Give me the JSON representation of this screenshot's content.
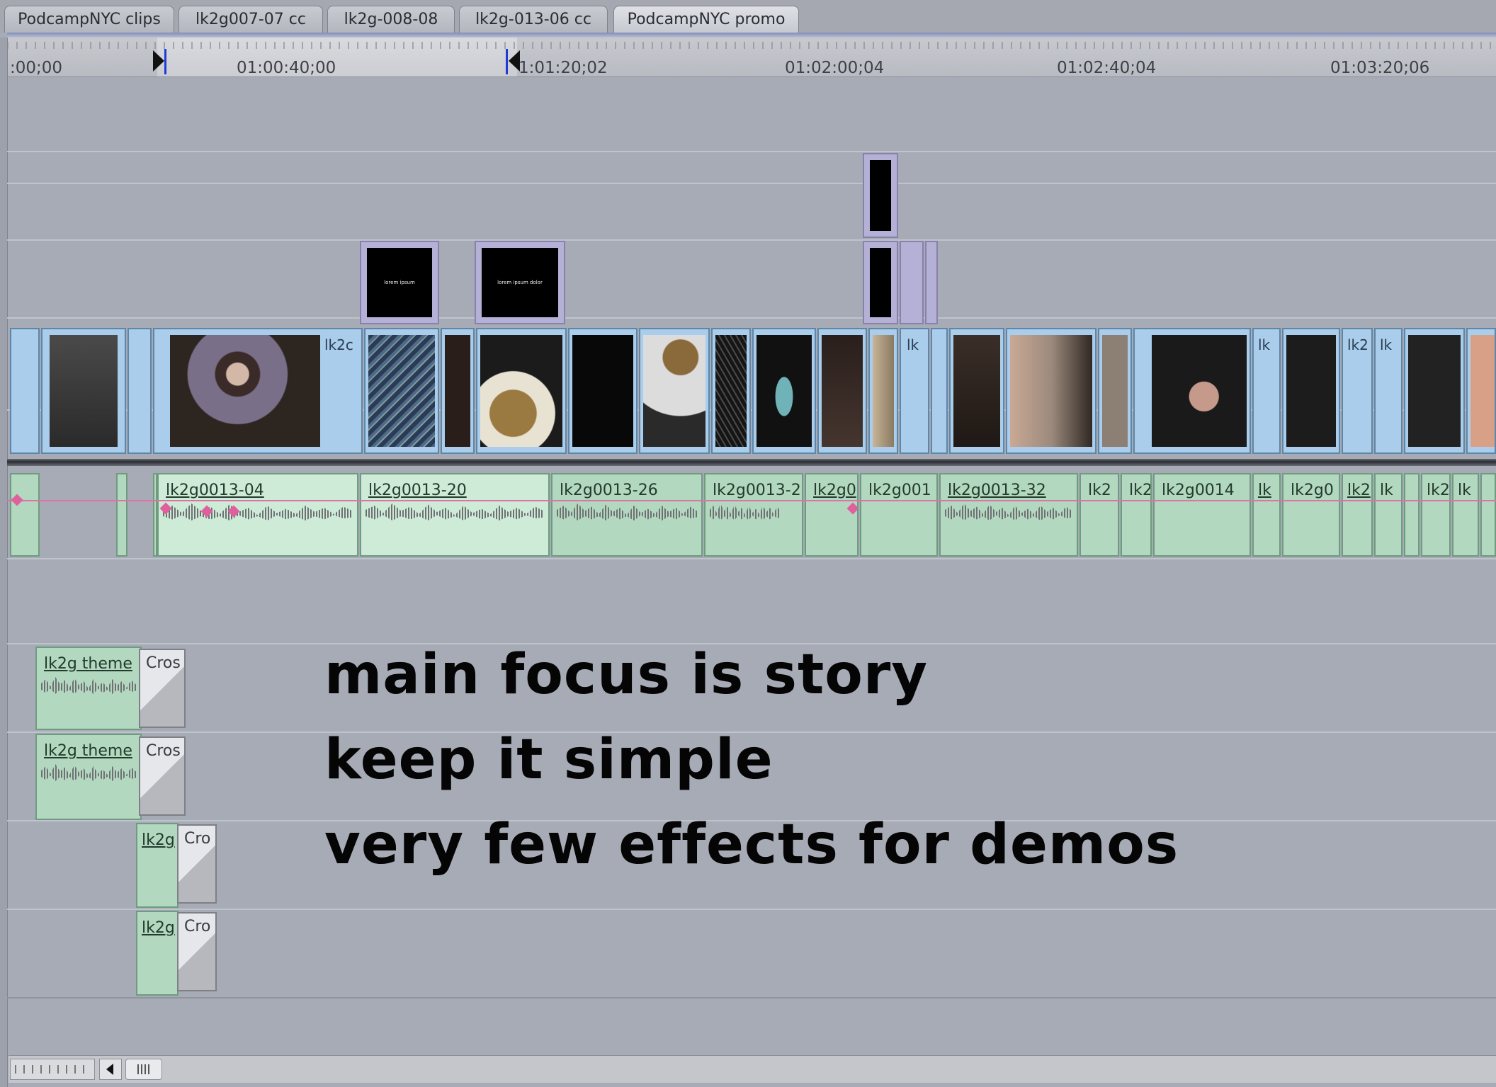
{
  "tabs": [
    {
      "label": "PodcampNYC clips"
    },
    {
      "label": "lk2g007-07 cc"
    },
    {
      "label": "lk2g-008-08"
    },
    {
      "label": "lk2g-013-06 cc"
    },
    {
      "label": "PodcampNYC promo"
    }
  ],
  "ruler": {
    "timecodes": [
      ":00;00",
      "01:00:40;00",
      "1:01:20;02",
      "01:02:00;04",
      "01:02:40;04",
      "01:03:20;06"
    ]
  },
  "video_clips": {
    "labels": [
      "lk2c",
      "lk",
      "lk",
      "lk2",
      "lk"
    ]
  },
  "audio_clips": {
    "labels": [
      "lk2g0013-04",
      "lk2g0013-20",
      "lk2g0013-26",
      "lk2g0013-2",
      "lk2g0",
      "lk2g001",
      "lk2g0013-32",
      "lk2",
      "lk2",
      "lk2g0014",
      "lk",
      "lk2g0",
      "lk2",
      "lk",
      "lk2",
      "lk"
    ]
  },
  "music_clips": {
    "theme_label": "lk2g theme",
    "short_label": "lk2g",
    "transition_label": "Cros",
    "transition_short": "Cro"
  },
  "titles": {
    "text_a": "lorem ipsum",
    "text_b": "lorem ipsum dolor"
  },
  "overlay": {
    "line1": "main focus is story",
    "line2": "keep it simple",
    "line3": "very few effects for demos"
  },
  "colors": {
    "video_clip": "#a9cdea",
    "audio_clip": "#b3d8c0",
    "title_clip": "#b5b0d6",
    "playhead": "#1e3bd6"
  }
}
